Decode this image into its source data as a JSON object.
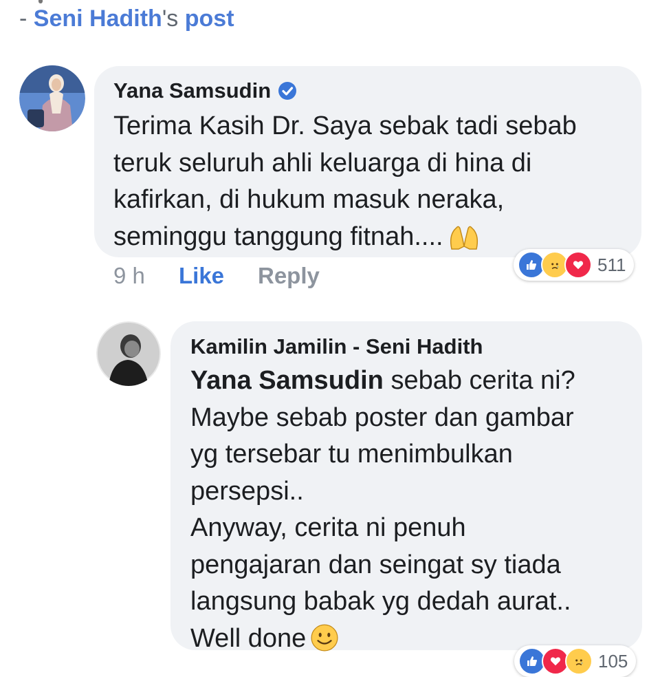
{
  "header": {
    "prefix": "- ",
    "author": "Seni Hadith",
    "possessive": "'s",
    "suffix": " post"
  },
  "comments": [
    {
      "author": "Yana Samsudin",
      "verified": true,
      "lines": [
        "Terima Kasih Dr. Saya sebak tadi sebab",
        "teruk seluruh ahli keluarga di hina di",
        "kafirkan, di hukum masuk neraka,",
        "seminggu tanggung fitnah...."
      ],
      "emoji": "praying-hands-icon",
      "time": "9 h",
      "like_label": "Like",
      "reply_label": "Reply",
      "reactions": [
        "like-icon",
        "sad-icon",
        "love-icon"
      ],
      "reaction_count": "511"
    },
    {
      "author": "Kamilin Jamilin - Seni Hadith",
      "mention": "Yana Samsudin",
      "first_line_rest": " sebab cerita ni?",
      "lines": [
        "Maybe sebab poster dan gambar",
        "yg tersebar tu menimbulkan",
        "persepsi..",
        "Anyway, cerita ni penuh",
        "pengajaran dan seingat sy tiada",
        "langsung babak yg dedah aurat..",
        "Well done"
      ],
      "emoji": "smiley-icon",
      "reactions": [
        "like-icon",
        "love-icon",
        "sad-icon"
      ],
      "reaction_count": "105"
    }
  ],
  "colors": {
    "link": "#4b7bd6",
    "bubble": "#f0f2f5",
    "like_blue": "#3a76d8",
    "love_red": "#f0284a",
    "muted": "#8d949e"
  }
}
